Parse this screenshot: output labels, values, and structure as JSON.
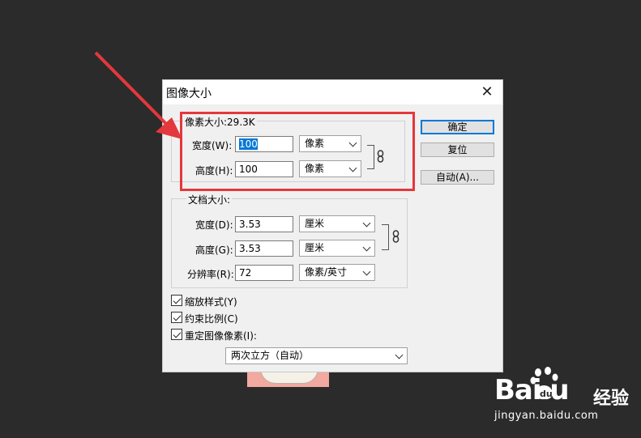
{
  "dialog": {
    "title": "图像大小",
    "close_label": "✕"
  },
  "pixel_size": {
    "legend": "像素大小:29.3K",
    "width_label": "宽度(W):",
    "width_value": "100",
    "width_unit": "像素",
    "height_label": "高度(H):",
    "height_value": "100",
    "height_unit": "像素"
  },
  "doc_size": {
    "legend": "文档大小:",
    "width_label": "宽度(D):",
    "width_value": "3.53",
    "width_unit": "厘米",
    "height_label": "高度(G):",
    "height_value": "3.53",
    "height_unit": "厘米",
    "resolution_label": "分辨率(R):",
    "resolution_value": "72",
    "resolution_unit": "像素/英寸"
  },
  "buttons": {
    "ok": "确定",
    "reset": "复位",
    "auto": "自动(A)..."
  },
  "options": {
    "scale_styles": "缩放样式(Y)",
    "constrain": "约束比例(C)",
    "resample": "重定图像像素(I):",
    "resample_method": "两次立方（自动）"
  },
  "watermark": {
    "logo": "Bai  u",
    "experience": "经验",
    "site": "jingyan.baidu.com"
  },
  "colors": {
    "highlight_box": "#e3383d",
    "arrow": "#e3383d",
    "selection": "#0078d7"
  }
}
